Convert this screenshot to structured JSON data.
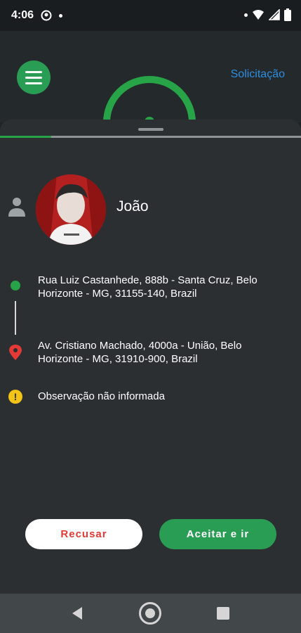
{
  "status_bar": {
    "time": "4:06",
    "left_icons": [
      "app-notification-icon",
      "dot-icon"
    ],
    "right_icons": [
      "dot-icon",
      "wifi-icon",
      "signal-icon",
      "battery-icon"
    ]
  },
  "header": {
    "menu_icon": "hamburger-menu-icon",
    "request_label": "Solicitação"
  },
  "sheet": {
    "progress_fraction": 0.17,
    "passenger": {
      "name": "João",
      "avatar_icon": "person-avatar"
    },
    "origin": {
      "address": "Rua Luiz Castanhede, 888b - Santa Cruz, Belo Horizonte - MG, 31155-140, Brazil"
    },
    "destination": {
      "address": "Av. Cristiano Machado, 4000a - União, Belo Horizonte - MG, 31910-900, Brazil"
    },
    "observation": "Observação não informada",
    "decline_label": "Recusar",
    "accept_label": "Aceitar e ir"
  },
  "colors": {
    "accent": "#2a9d55",
    "link": "#2e8ee0",
    "decline_text": "#e53935",
    "warning": "#f3c316",
    "pin": "#e53935"
  },
  "nav_bar": {
    "icons": [
      "back-icon",
      "home-icon",
      "recents-icon"
    ]
  }
}
